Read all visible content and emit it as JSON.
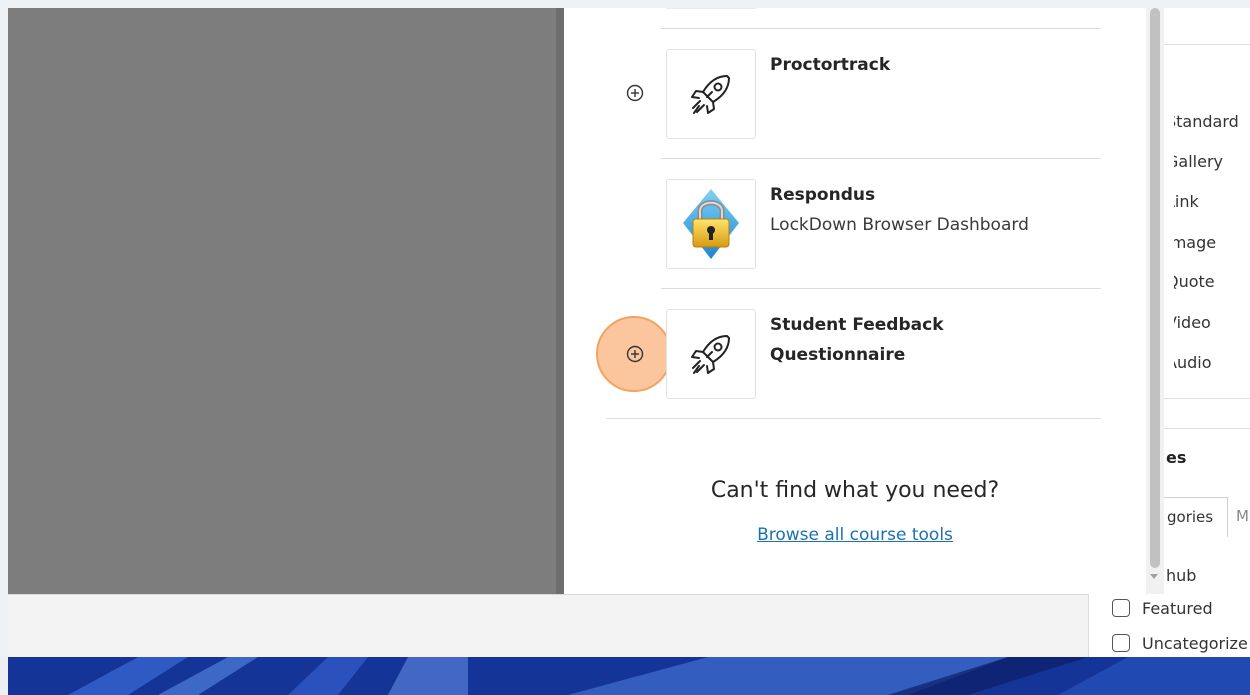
{
  "panel": {
    "tools": [
      {
        "title": "Proctortrack",
        "subtitle": "",
        "icon": "rocket-icon",
        "has_add": true,
        "highlighted": false
      },
      {
        "title": "Respondus",
        "subtitle": "LockDown Browser Dashboard",
        "icon": "padlock-icon",
        "has_add": false,
        "highlighted": false
      },
      {
        "title": "Student Feedback",
        "title_line2": "Questionnaire",
        "subtitle": "",
        "icon": "rocket-icon",
        "has_add": true,
        "highlighted": true
      }
    ],
    "cant_find": "Can't find what you need?",
    "browse_link": "Browse all course tools"
  },
  "background_page": {
    "block_types": [
      "Standard",
      "Gallery",
      "Link",
      "Image",
      "Quote",
      "Video",
      "Audio"
    ],
    "categories_header": "es",
    "tabs": [
      "gories",
      "M"
    ],
    "list_first": "hub",
    "checkboxes": [
      "Featured",
      "Uncategorize"
    ]
  },
  "colors": {
    "accent_link": "#1b72ad",
    "highlight": "#f9af78",
    "overlay": "#7d7d7d"
  }
}
